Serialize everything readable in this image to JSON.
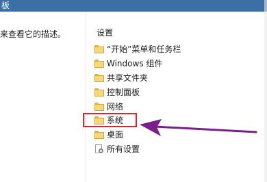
{
  "window": {
    "title": "板"
  },
  "left_pane": {
    "description": "来查看它的描述。"
  },
  "list": {
    "header": "设置",
    "items": [
      {
        "label": "“开始”菜单和任务栏",
        "icon": "folder-icon"
      },
      {
        "label": "Windows 组件",
        "icon": "folder-icon"
      },
      {
        "label": "共享文件夹",
        "icon": "folder-icon"
      },
      {
        "label": "控制面板",
        "icon": "folder-icon"
      },
      {
        "label": "网络",
        "icon": "folder-icon"
      },
      {
        "label": "系统",
        "icon": "folder-icon"
      },
      {
        "label": "桌面",
        "icon": "folder-icon"
      },
      {
        "label": "所有设置",
        "icon": "settings-icon"
      }
    ]
  },
  "annotation": {
    "highlight_color": "#e0242b",
    "arrow_color": "#7b1e8c",
    "highlighted_item": "系统"
  }
}
